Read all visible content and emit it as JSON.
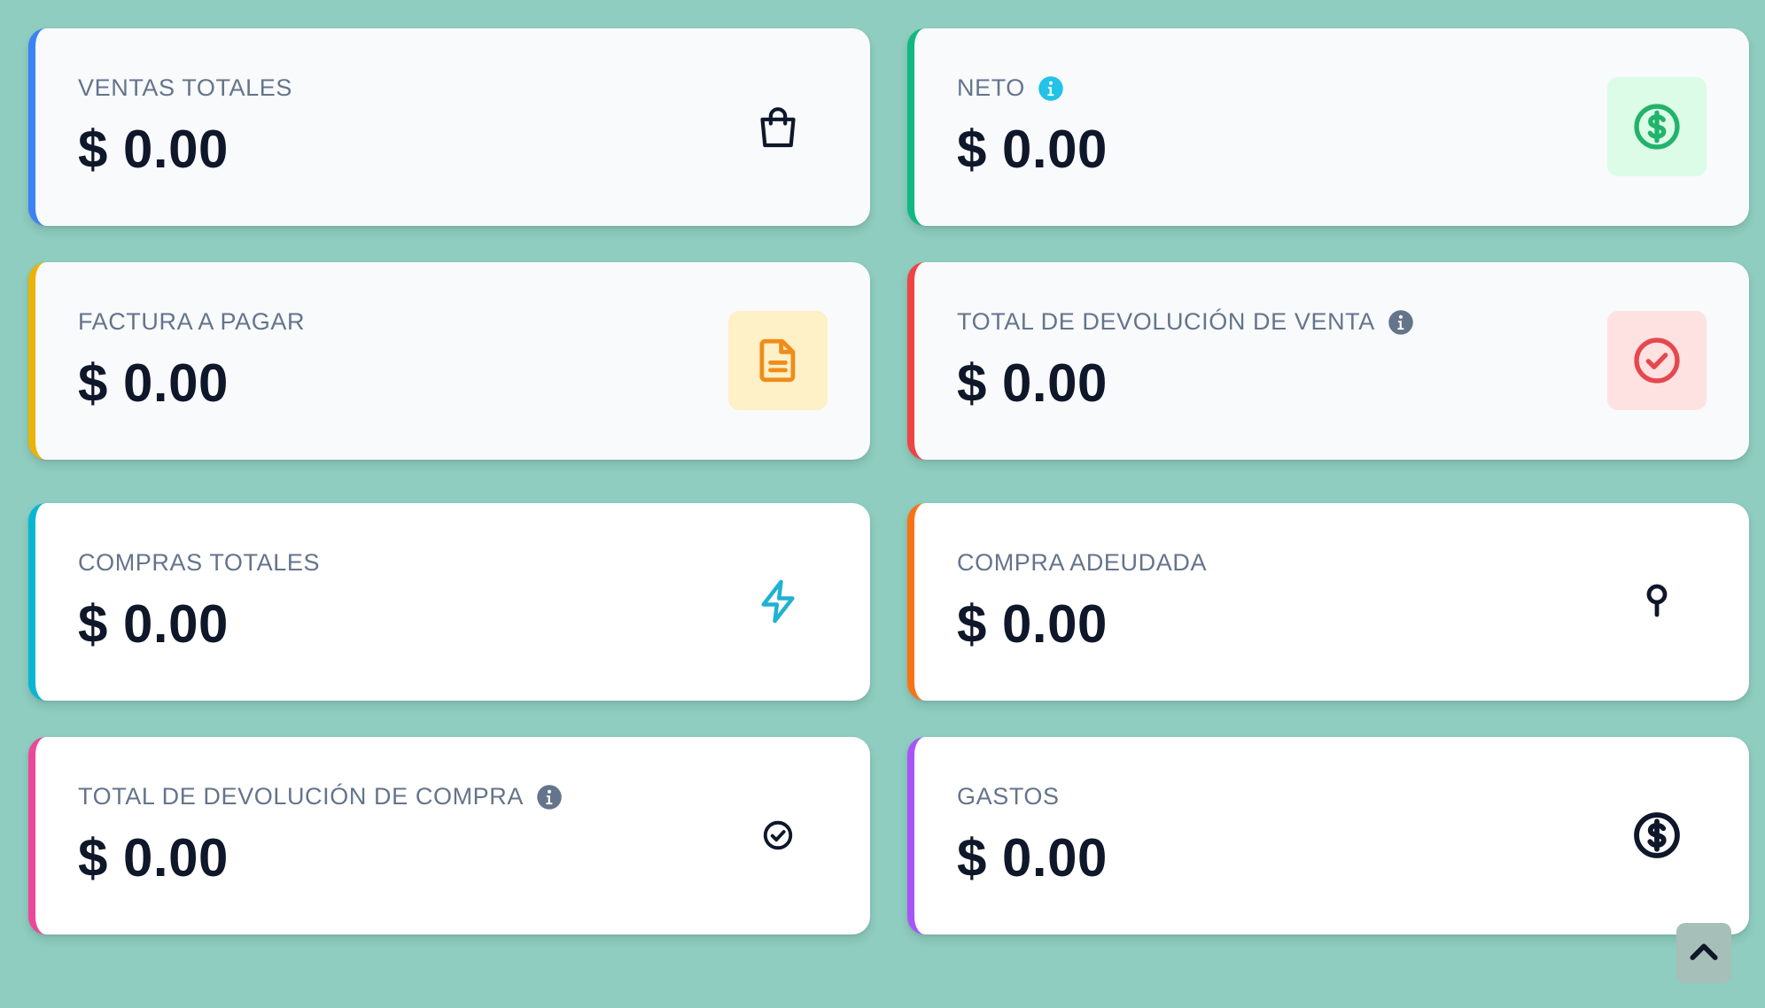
{
  "cards": [
    {
      "label": "VENTAS TOTALES",
      "value": "$ 0.00",
      "has_info": false,
      "icon": "shopping-bag-icon",
      "accent": "#3b82f6"
    },
    {
      "label": "NETO",
      "value": "$ 0.00",
      "has_info": true,
      "info_color": "#22c3e6",
      "icon": "dollar-circle-icon",
      "accent": "#10b981",
      "icon_bg": "#dcfce7",
      "icon_color": "#22b36b"
    },
    {
      "label": "FACTURA A PAGAR",
      "value": "$ 0.00",
      "has_info": false,
      "icon": "document-icon",
      "accent": "#eab308",
      "icon_bg": "#fef0c7",
      "icon_color": "#f08c1a"
    },
    {
      "label": "TOTAL DE DEVOLUCIÓN DE VENTA",
      "value": "$ 0.00",
      "has_info": true,
      "info_color": "#64748b",
      "icon": "check-circle-icon",
      "accent": "#ef4444",
      "icon_bg": "#fee2e2",
      "icon_color": "#e5484d"
    },
    {
      "label": "COMPRAS TOTALES",
      "value": "$ 0.00",
      "has_info": false,
      "icon": "lightning-icon",
      "accent": "#06b6d4",
      "icon_color": "#1fb2d2"
    },
    {
      "label": "COMPRA ADEUDADA",
      "value": "$ 0.00",
      "has_info": false,
      "icon": "pin-icon",
      "accent": "#f97316"
    },
    {
      "label": "TOTAL DE DEVOLUCIÓN DE COMPRA",
      "value": "$ 0.00",
      "has_info": true,
      "info_color": "#64748b",
      "icon": "check-badge-icon",
      "accent": "#ec4899"
    },
    {
      "label": "GASTOS",
      "value": "$ 0.00",
      "has_info": false,
      "icon": "dollar-circle-outline-icon",
      "accent": "#a855f7"
    }
  ],
  "scroll_top": {
    "icon": "chevron-up-icon"
  }
}
